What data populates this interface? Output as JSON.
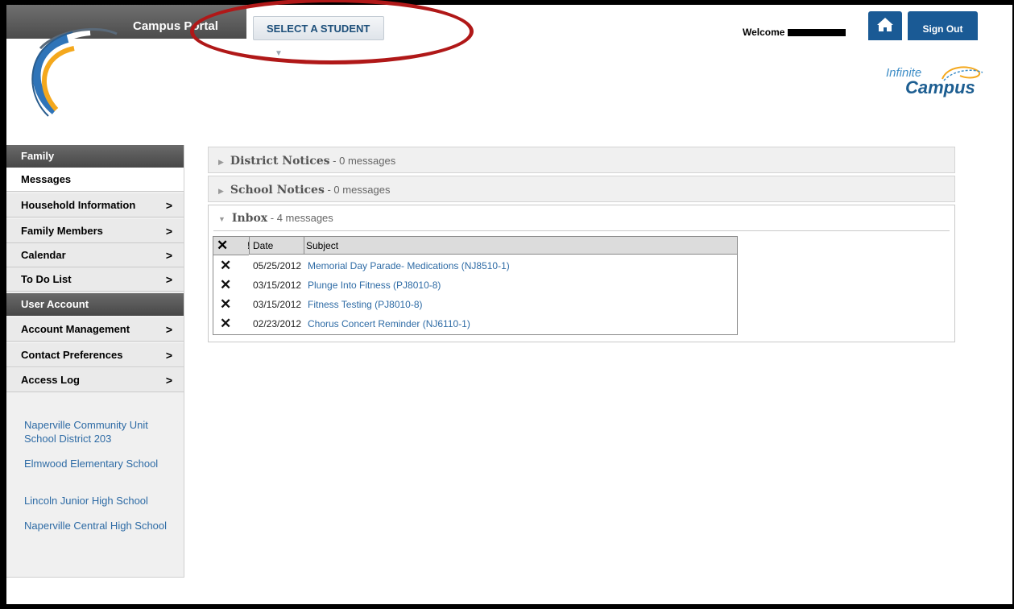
{
  "header": {
    "portal_title": "Campus Portal",
    "select_student": "SELECT A STUDENT",
    "welcome": "Welcome",
    "home_icon": "home-icon",
    "sign_out": "Sign Out",
    "logo_line1": "Infinite",
    "logo_line2": "Campus"
  },
  "sidebar": {
    "family_header": "Family",
    "family_items": [
      {
        "label": "Messages"
      },
      {
        "label": "Household Information",
        "arrow": ">"
      },
      {
        "label": "Family Members",
        "arrow": ">"
      },
      {
        "label": "Calendar",
        "arrow": ">"
      },
      {
        "label": "To Do List",
        "arrow": ">"
      }
    ],
    "account_header": "User Account",
    "account_items": [
      {
        "label": "Account Management",
        "arrow": ">"
      },
      {
        "label": "Contact Preferences",
        "arrow": ">"
      },
      {
        "label": "Access Log",
        "arrow": ">"
      }
    ],
    "links": [
      "Naperville Community Unit School District 203",
      "Elmwood Elementary School",
      "Lincoln Junior High School",
      "Naperville Central High School"
    ]
  },
  "main": {
    "district_notices": {
      "title": "District Notices",
      "count": "- 0 messages"
    },
    "school_notices": {
      "title": "School Notices",
      "count": "- 0 messages"
    },
    "inbox": {
      "title": "Inbox",
      "count": "- 4 messages",
      "columns": {
        "priority": "!",
        "date": "Date",
        "subject": "Subject"
      },
      "rows": [
        {
          "date": "05/25/2012",
          "subject": "Memorial Day Parade- Medications (NJ8510-1)"
        },
        {
          "date": "03/15/2012",
          "subject": "Plunge Into Fitness (PJ8010-8)"
        },
        {
          "date": "03/15/2012",
          "subject": "Fitness Testing (PJ8010-8)"
        },
        {
          "date": "02/23/2012",
          "subject": "Chorus Concert Reminder (NJ6110-1)"
        }
      ]
    }
  }
}
